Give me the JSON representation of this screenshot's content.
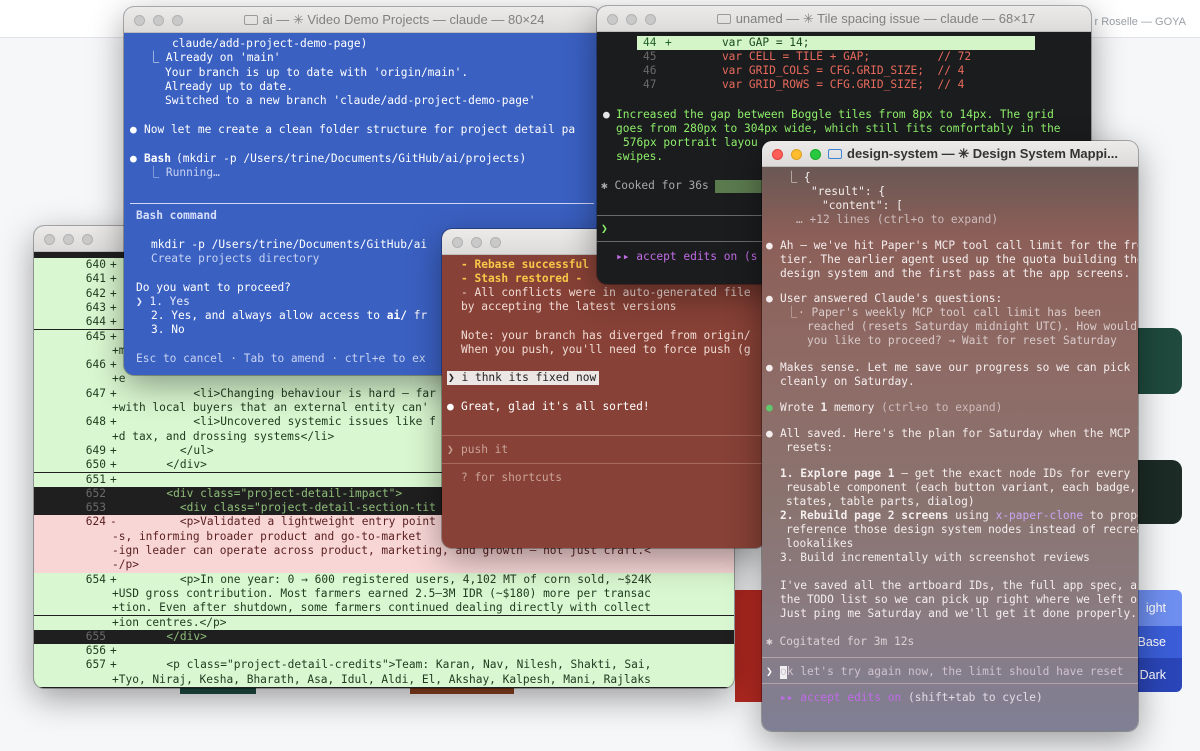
{
  "background": {
    "header_text": "r Roselle — GOYA",
    "buttons": [
      "ight",
      "Base",
      "Dark"
    ]
  },
  "colors": {
    "terminal_blue": "#3a60c2",
    "diff_add": "#d9f7d0",
    "diff_del": "#f8d6d6",
    "accent_purple": "#c06be6"
  },
  "win_ai": {
    "title": "ai — ✳ Video Demo Projects — claude — 80×24",
    "lines": [
      "claude/add-project-demo-page)",
      "⎿ Already on 'main'",
      "Your branch is up to date with 'origin/main'.",
      "Already up to date.",
      "Switched to a new branch 'claude/add-project-demo-page'",
      "Now let me create a clean folder structure for project detail pa",
      "Bash",
      "(mkdir -p /Users/trine/Documents/GitHub/ai/projects)",
      "⎿ Running…"
    ],
    "dialog": {
      "heading": "Bash command",
      "command": "mkdir -p /Users/trine/Documents/GitHub/ai",
      "description": "Create projects directory",
      "question": "Do you want to proceed?",
      "options": [
        "❯ 1. Yes",
        "2. Yes, and always allow access to",
        "ai/",
        "fr",
        "3. No"
      ],
      "footer": "Esc to cancel · Tab to amend · ctrl+e to ex"
    }
  },
  "win_diff": {
    "rows": [
      {
        "num": "640",
        "sign": "+",
        "text": "",
        "kind": "add"
      },
      {
        "num": "641",
        "sign": "+",
        "text": "",
        "kind": "add"
      },
      {
        "num": "642",
        "sign": "+",
        "text": "",
        "kind": "add"
      },
      {
        "num": "643",
        "sign": "+",
        "text": "",
        "kind": "add"
      },
      {
        "num": "644",
        "sign": "+",
        "text": "",
        "kind": "add"
      },
      {
        "num": "645",
        "sign": "+",
        "text": "",
        "kind": "add"
      },
      {
        "num": "",
        "sign": "",
        "text": "+m",
        "kind": "add"
      },
      {
        "num": "646",
        "sign": "+",
        "text": "",
        "kind": "add"
      },
      {
        "num": "",
        "sign": "",
        "text": "+e",
        "kind": "add"
      },
      {
        "num": "647",
        "sign": "+",
        "text": "          <li>Changing behaviour is hard — far",
        "kind": "add"
      },
      {
        "num": "",
        "sign": "",
        "text": "+with local buyers that an external entity can'",
        "kind": "add"
      },
      {
        "num": "648",
        "sign": "+",
        "text": "          <li>Uncovered systemic issues like f",
        "kind": "add"
      },
      {
        "num": "",
        "sign": "",
        "text": "+d tax, and drossing systems</li>",
        "kind": "add"
      },
      {
        "num": "649",
        "sign": "+",
        "text": "        </ul>",
        "kind": "add"
      },
      {
        "num": "650",
        "sign": "+",
        "text": "      </div>",
        "kind": "add"
      },
      {
        "num": "651",
        "sign": "+",
        "text": "",
        "kind": "add"
      },
      {
        "num": "652",
        "sign": "",
        "text": "      <div class=\"project-detail-impact\">",
        "kind": "ctx"
      },
      {
        "num": "653",
        "sign": "",
        "text": "        <div class=\"project-detail-section-tit",
        "kind": "ctx"
      },
      {
        "num": "624",
        "sign": "-",
        "text": "        <p>Validated a lightweight entry point",
        "kind": "del"
      },
      {
        "num": "",
        "sign": "",
        "text": "-s, informing broader product and go-to-market",
        "kind": "del"
      },
      {
        "num": "",
        "sign": "",
        "text": "-ign leader can operate across product, marketing, and growth — not just craft.<",
        "kind": "del"
      },
      {
        "num": "",
        "sign": "",
        "text": "-/p>",
        "kind": "del"
      },
      {
        "num": "654",
        "sign": "+",
        "text": "        <p>In one year: 0 → 600 registered users, 4,102 MT of corn sold, ~$24K",
        "kind": "add"
      },
      {
        "num": "",
        "sign": "",
        "text": "+USD gross contribution. Most farmers earned 2.5–3M IDR (~$180) more per transac",
        "kind": "add"
      },
      {
        "num": "",
        "sign": "",
        "text": "+tion. Even after shutdown, some farmers continued dealing directly with collect",
        "kind": "add"
      },
      {
        "num": "",
        "sign": "",
        "text": "+ion centres.</p>",
        "kind": "add"
      },
      {
        "num": "655",
        "sign": "",
        "text": "      </div>",
        "kind": "ctx"
      },
      {
        "num": "656",
        "sign": "+",
        "text": "",
        "kind": "add"
      },
      {
        "num": "657",
        "sign": "+",
        "text": "      <p class=\"project-detail-credits\">Team: Karan, Nav, Nilesh, Shakti, Sai,",
        "kind": "add"
      },
      {
        "num": "",
        "sign": "",
        "text": "+Tyo, Niraj, Kesha, Bharath, Asa, Idul, Aldi, El, Akshay, Kalpesh, Mani, Rajlaks",
        "kind": "add"
      }
    ]
  },
  "win_rebase": {
    "lines": [
      "- Rebase successful",
      "- Stash restored -",
      "- All conflicts were in auto-generated file",
      "by accepting the latest versions",
      "Note: your branch has diverged from origin/",
      "When you push, you'll need to force push (g"
    ],
    "user_msg": "i thnk its fixed now",
    "reply": "Great, glad it's all sorted!",
    "prompt": "push it",
    "hint": "? for shortcuts"
  },
  "win_unamed": {
    "title": "unamed — ✳ Tile spacing issue — claude — 68×17",
    "code": [
      {
        "num": "44",
        "sign": "+",
        "text": "    var GAP = 14;"
      },
      {
        "num": "45",
        "sign": "",
        "text": "    var CELL = TILE + GAP;          // 72"
      },
      {
        "num": "46",
        "sign": "",
        "text": "    var GRID_COLS = CFG.GRID_SIZE;  // 4"
      },
      {
        "num": "47",
        "sign": "",
        "text": "    var GRID_ROWS = CFG.GRID_SIZE;  // 4"
      }
    ],
    "message": [
      "Increased the gap between Boggle tiles from 8px to 14px. The grid",
      "goes from 280px to 304px wide, which still fits comfortably in the",
      "576px portrait layou",
      "swipes."
    ],
    "status": "✱ Cooked for 36s",
    "prompt_mark": "❯",
    "accept": "▸▸ accept edits on (s"
  },
  "win_design": {
    "title": "design-system — ✳ Design System Mappi...",
    "result": [
      "⎿ {",
      "\"result\": {",
      "\"content\": [",
      "… +12 lines (ctrl+o to expand)"
    ],
    "p1": [
      "Ah — we've hit Paper's MCP tool call limit for the free",
      "tier. The earlier agent used up the quota building the",
      "design system and the first pass at the app screens."
    ],
    "p2": "User answered Claude's questions:",
    "p2sub": [
      "· Paper's weekly MCP tool call limit has been",
      "reached (resets Saturday midnight UTC). How would",
      "you like to proceed? → Wait for reset Saturday"
    ],
    "p3": [
      "Makes sense. Let me save our progress so we can pick up",
      "cleanly on Saturday."
    ],
    "mem": {
      "a": "Wrote",
      "b": "1",
      "c": "memory",
      "d": "(ctrl+o to expand)"
    },
    "p4": [
      "All saved. Here's the plan for Saturday when the MCP limit",
      "resets:"
    ],
    "plan1": {
      "n": "1.",
      "b": "Explore page 1",
      "r": " — get the exact node IDs for every",
      "c1": "reusable component (each button variant, each badge, input",
      "c2": "states, table parts, dialog)"
    },
    "plan2": {
      "n": "2.",
      "b": "Rebuild page 2 screens",
      "r": " using ",
      "code": "x-paper-clone",
      "r2": " to properly",
      "c1": "reference those design system nodes instead of recreating",
      "c2": "lookalikes"
    },
    "plan3": "3. Build incrementally with screenshot reviews",
    "p5": [
      "I've saved all the artboard IDs, the full app spec, and",
      "the TODO list so we can pick up right where we left off.",
      "Just ping me Saturday and we'll get it done properly."
    ],
    "status": "✱ Cogitated for 3m 12s",
    "input": "ok let's try again now, the limit should have reset",
    "accept_a": "▸▸ accept edits on",
    "accept_b": "(shift+tab to cycle)"
  }
}
